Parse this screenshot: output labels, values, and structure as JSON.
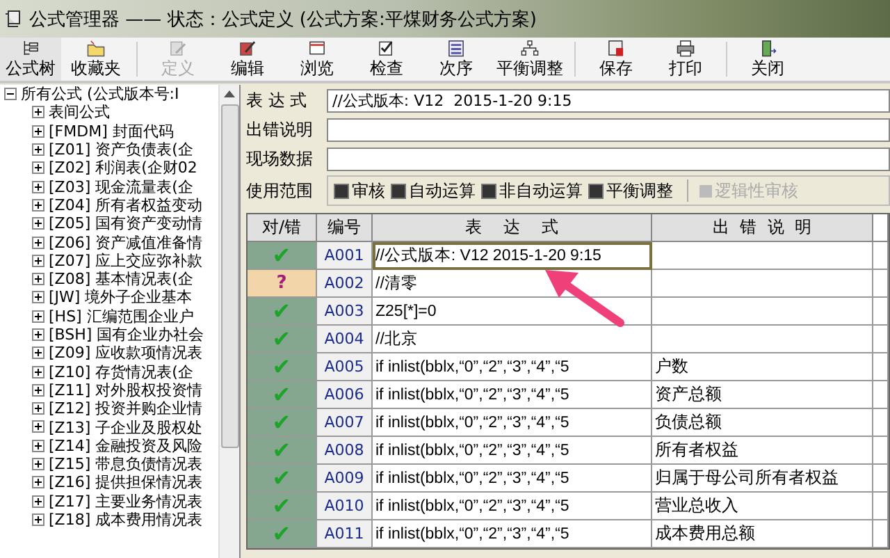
{
  "window": {
    "title": "公式管理器 —— 状态：公式定义 (公式方案:平煤财务公式方案)"
  },
  "toolbar": [
    [
      {
        "label": "公式树",
        "disabled": false
      },
      {
        "label": "收藏夹",
        "disabled": false
      }
    ],
    [
      {
        "label": "定义",
        "disabled": true
      },
      {
        "label": "编辑",
        "disabled": false
      },
      {
        "label": "浏览",
        "disabled": false
      },
      {
        "label": "检查",
        "disabled": false
      },
      {
        "label": "次序",
        "disabled": false
      },
      {
        "label": "平衡调整",
        "disabled": false
      }
    ],
    [
      {
        "label": "保存",
        "disabled": false
      },
      {
        "label": "打印",
        "disabled": false
      }
    ],
    [
      {
        "label": "关闭",
        "disabled": false
      }
    ]
  ],
  "tree": {
    "label": "所有公式 (公式版本号:I",
    "expanded": true,
    "children": [
      {
        "label": "表间公式",
        "expanded": false
      },
      {
        "label": "[FMDM] 封面代码",
        "expanded": false
      },
      {
        "label": "[Z01] 资产负债表(企",
        "expanded": false
      },
      {
        "label": "[Z02] 利润表(企财02",
        "expanded": false
      },
      {
        "label": "[Z03] 现金流量表(企",
        "expanded": false
      },
      {
        "label": "[Z04] 所有者权益变动",
        "expanded": false
      },
      {
        "label": "[Z05] 国有资产变动情",
        "expanded": false
      },
      {
        "label": "[Z06] 资产减值准备情",
        "expanded": false
      },
      {
        "label": "[Z07] 应上交应弥补款",
        "expanded": false
      },
      {
        "label": "[Z08] 基本情况表(企",
        "expanded": false
      },
      {
        "label": "[JW] 境外子企业基本",
        "expanded": false
      },
      {
        "label": "[HS] 汇编范围企业户",
        "expanded": false
      },
      {
        "label": "[BSH] 国有企业办社会",
        "expanded": false
      },
      {
        "label": "[Z09] 应收款项情况表",
        "expanded": false
      },
      {
        "label": "[Z10] 存货情况表(企",
        "expanded": false
      },
      {
        "label": "[Z11] 对外股权投资情",
        "expanded": false
      },
      {
        "label": "[Z12] 投资并购企业情",
        "expanded": false
      },
      {
        "label": "[Z13] 子企业及股权处",
        "expanded": false
      },
      {
        "label": "[Z14] 金融投资及风险",
        "expanded": false
      },
      {
        "label": "[Z15] 带息负债情况表",
        "expanded": false
      },
      {
        "label": "[Z16] 提供担保情况表",
        "expanded": false
      },
      {
        "label": "[Z17] 主要业务情况表",
        "expanded": false
      },
      {
        "label": "[Z18] 成本费用情况表",
        "expanded": false
      }
    ]
  },
  "fields": [
    {
      "label": "表 达 式",
      "value": "//公式版本: V12  2015-1-20 9:15"
    },
    {
      "label": "出错说明"
    },
    {
      "label": "现场数据"
    }
  ],
  "usage": {
    "label": "使用范围",
    "options": [
      {
        "label": "审核",
        "checked": true,
        "disabled": false
      },
      {
        "label": "自动运算",
        "checked": true,
        "disabled": false
      },
      {
        "label": "非自动运算",
        "checked": true,
        "disabled": false
      },
      {
        "label": "平衡调整",
        "checked": true,
        "disabled": false
      },
      {
        "label": "逻辑性审核",
        "checked": false,
        "disabled": true
      }
    ]
  },
  "table": {
    "columns": [
      "对/错",
      "编号",
      "表    达    式",
      "出  错  说  明"
    ],
    "rows": [
      {
        "correct": true,
        "mark": "✔",
        "id": "A001",
        "expression": "//公式版本: V12  2015-1-20 9:15",
        "message": "",
        "selected": true
      },
      {
        "correct": false,
        "mark": "?",
        "id": "A002",
        "expression": "//清零",
        "message": "",
        "selected": false
      },
      {
        "correct": true,
        "mark": "✔",
        "id": "A003",
        "expression": "Z25[*]=0",
        "message": "",
        "selected": false
      },
      {
        "correct": true,
        "mark": "✔",
        "id": "A004",
        "expression": "//北京",
        "message": "",
        "selected": false
      },
      {
        "correct": true,
        "mark": "✔",
        "id": "A005",
        "expression": "if inlist(bblx,“0”,“2”,“3”,“4”,“5",
        "message": "户数",
        "selected": false
      },
      {
        "correct": true,
        "mark": "✔",
        "id": "A006",
        "expression": "if inlist(bblx,“0”,“2”,“3”,“4”,“5",
        "message": "资产总额",
        "selected": false
      },
      {
        "correct": true,
        "mark": "✔",
        "id": "A007",
        "expression": "if inlist(bblx,“0”,“2”,“3”,“4”,“5",
        "message": "负债总额",
        "selected": false
      },
      {
        "correct": true,
        "mark": "✔",
        "id": "A008",
        "expression": "if inlist(bblx,“0”,“2”,“3”,“4”,“5",
        "message": "所有者权益",
        "selected": false
      },
      {
        "correct": true,
        "mark": "✔",
        "id": "A009",
        "expression": "if inlist(bblx,“0”,“2”,“3”,“4”,“5",
        "message": "归属于母公司所有者权益",
        "selected": false
      },
      {
        "correct": true,
        "mark": "✔",
        "id": "A010",
        "expression": "if inlist(bblx,“0”,“2”,“3”,“4”,“5",
        "message": "营业总收入",
        "selected": false
      },
      {
        "correct": true,
        "mark": "✔",
        "id": "A011",
        "expression": "if inlist(bblx,“0”,“2”,“3”,“4”,“5",
        "message": "成本费用总额",
        "selected": false
      }
    ]
  }
}
